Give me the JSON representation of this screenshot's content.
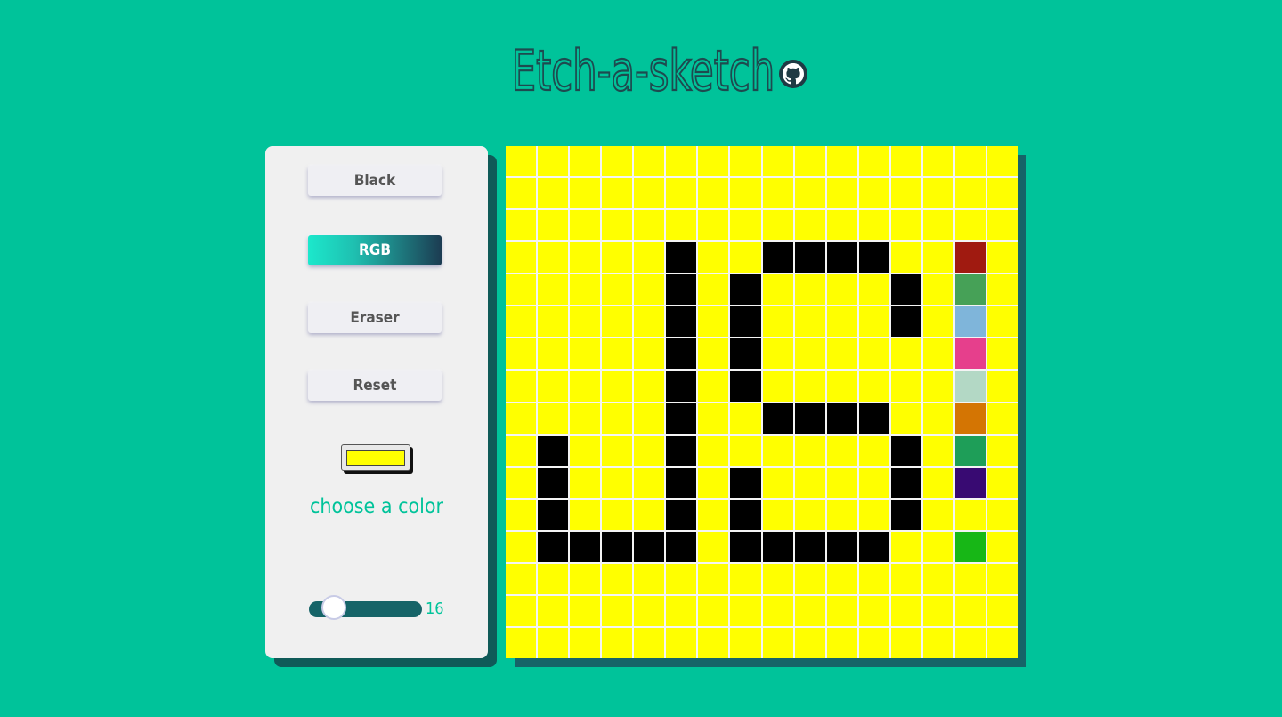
{
  "title": "Etch-a-sketch",
  "buttons": {
    "black": "Black",
    "rgb": "RGB",
    "eraser": "Eraser",
    "reset": "Reset"
  },
  "color_picker": {
    "value": "#ffff00",
    "label": "choose a color"
  },
  "slider": {
    "value": "16"
  },
  "grid": {
    "size": 16,
    "background": "#ffff00",
    "cells": [
      "YYYYYYYYYYYYYYYY",
      "YYYYYYYYYYYYYYYY",
      "YYYYYYYYYYYYYYYY",
      "YYYYYKYYKKKKYYRY",
      "YYYYYKYKYYYYKYGY",
      "YYYYYKYKYYYYKYBY",
      "YYYYYKYKYYYYYYPY",
      "YYYYYKYKYYYYYYMY",
      "YYYYYKYYKKKKYYOY",
      "YKYYYKYYYYYYKYEY",
      "YKYYYKYKYYYYKYVY",
      "YKYYYKYKYYYYKYYY",
      "YKKKKKYKKKKKYYLY",
      "YYYYYYYYYYYYYYYY",
      "YYYYYYYYYYYYYYYY",
      "YYYYYYYYYYYYYYYY"
    ],
    "palette": {
      "Y": "#ffff00",
      "K": "#000000",
      "R": "#a01a10",
      "G": "#46a157",
      "B": "#7fb5da",
      "P": "#e63f8c",
      "M": "#b3d8c5",
      "O": "#d47503",
      "E": "#1e9e58",
      "V": "#380a72",
      "L": "#17b716"
    }
  }
}
